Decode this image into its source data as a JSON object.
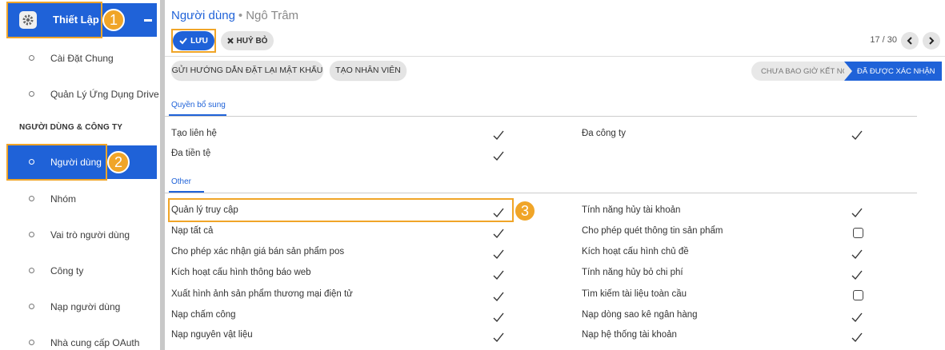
{
  "sidebar": {
    "header_title": "Thiết Lập",
    "section_title": "NGƯỜI DÙNG & CÔNG TY",
    "items": [
      {
        "label": "Cài Đặt Chung"
      },
      {
        "label": "Quản Lý Ứng Dụng Drive"
      },
      {
        "label": "Người dùng"
      },
      {
        "label": "Nhóm"
      },
      {
        "label": "Vai trò người dùng"
      },
      {
        "label": "Công ty"
      },
      {
        "label": "Nạp người dùng"
      },
      {
        "label": "Nhà cung cấp OAuth"
      }
    ]
  },
  "callouts": [
    "1",
    "2",
    "3"
  ],
  "breadcrumb": {
    "parent": "Người dùng",
    "separator": "•",
    "current": "Ngô Trâm"
  },
  "toolbar": {
    "save_label": "LƯU",
    "cancel_label": "HUỶ BỎ"
  },
  "pager": {
    "text": "17 / 30"
  },
  "actions": {
    "reset_password": "GỬI HƯỚNG DẪN ĐẶT LẠI MẬT KHẨU",
    "create_employee": "TẠO NHÂN VIÊN"
  },
  "stages": {
    "never_connected": "CHƯA BAO GIỜ KẾT NỐI",
    "confirmed": "ĐÃ ĐƯỢC XÁC NHẬN"
  },
  "sections": {
    "extra_rights": {
      "title": "Quyền bổ sung",
      "left": [
        {
          "label": "Tạo liên hệ",
          "checked": true
        },
        {
          "label": "Đa tiền tệ",
          "checked": true
        }
      ],
      "right": [
        {
          "label": "Đa công ty",
          "checked": true
        }
      ]
    },
    "other": {
      "title": "Other",
      "left": [
        {
          "label": "Quản lý truy cập",
          "checked": true
        },
        {
          "label": "Nạp tất cả",
          "checked": true
        },
        {
          "label": "Cho phép xác nhận giá bán sản phẩm pos",
          "checked": true
        },
        {
          "label": "Kích hoạt cấu hình thông báo web",
          "checked": true
        },
        {
          "label": "Xuất hình ảnh sản phẩm thương mại điện tử",
          "checked": true
        },
        {
          "label": "Nạp chấm công",
          "checked": true
        },
        {
          "label": "Nạp nguyên vật liệu",
          "checked": true
        }
      ],
      "right": [
        {
          "label": "Tính năng hủy tài khoản",
          "checked": true
        },
        {
          "label": "Cho phép quét thông tin sản phẩm",
          "checked": false
        },
        {
          "label": "Kích hoạt cấu hình chủ đề",
          "checked": true
        },
        {
          "label": "Tính năng hủy bỏ chi phí",
          "checked": true
        },
        {
          "label": "Tìm kiếm tài liệu toàn cầu",
          "checked": false
        },
        {
          "label": "Nạp dòng sao kê ngân hàng",
          "checked": true
        },
        {
          "label": "Nạp hệ thống tài khoản",
          "checked": true
        }
      ]
    }
  },
  "colors": {
    "primary": "#1f62d8",
    "callout": "#f0a528"
  }
}
